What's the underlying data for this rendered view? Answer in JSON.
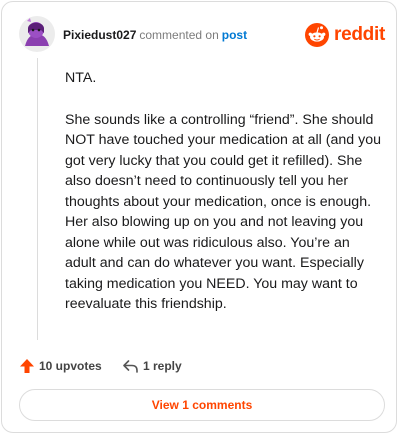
{
  "header": {
    "username": "Pixiedust027",
    "action_text": "commented on",
    "post_link": "post",
    "brand": "reddit"
  },
  "comment": {
    "paragraphs": [
      "NTA.",
      "She sounds like a controlling “friend”. She should NOT have touched your medication at all (and you got very lucky that you could get it refilled). She also doesn’t need to continuously tell you her thoughts about your medication, once is enough. Her also blowing up on you and not leaving you alone while out was ridiculous also. You’re an adult and can do whatever you want. Especially taking medication you NEED. You may want to reevaluate this friendship."
    ]
  },
  "actions": {
    "upvotes": "10 upvotes",
    "replies": "1 reply"
  },
  "footer": {
    "view_comments": "View 1 comments"
  },
  "colors": {
    "brand": "#ff4500",
    "link": "#0079d3",
    "avatar_bg": "#8b3fb0"
  },
  "icons": [
    "avatar-icon",
    "reddit-logo-icon",
    "upvote-arrow-icon",
    "reply-arrow-icon"
  ]
}
